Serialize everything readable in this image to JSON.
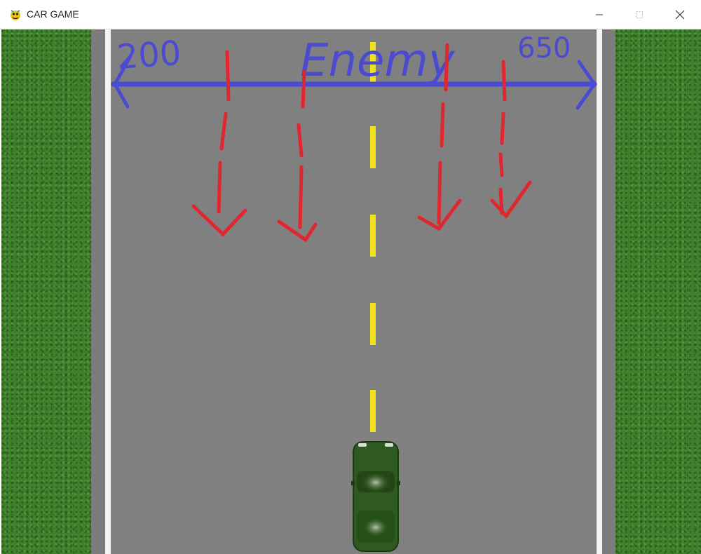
{
  "window": {
    "title": "CAR GAME",
    "app_icon": "pygame-snake-icon"
  },
  "annotations": {
    "left_value": "200",
    "right_value": "650",
    "enemy_label": "Enemy"
  },
  "player": {
    "color": "#2f5a1f"
  },
  "colors": {
    "road": "#808080",
    "grass": "#3f7f2c",
    "lane_marking": "#f2e21b",
    "annotation_axis": "#4a4bd0",
    "annotation_arrows": "#e0262e"
  }
}
